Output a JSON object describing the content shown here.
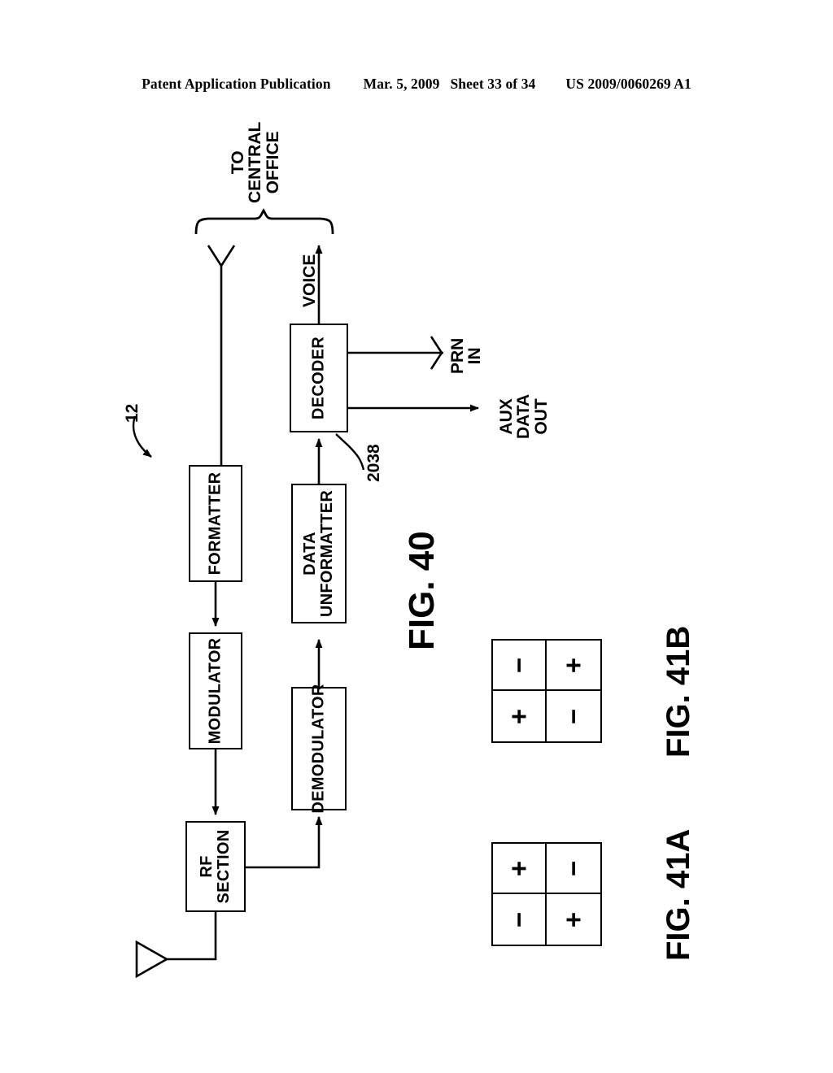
{
  "header": {
    "publication": "Patent Application Publication",
    "date": "Mar. 5, 2009",
    "sheet": "Sheet 33 of 34",
    "docnumber": "US 2009/0060269 A1"
  },
  "figure40": {
    "caption": "FIG. 40",
    "system_ref": "12",
    "decoder_ref": "2038",
    "brace_label": "TO\nCENTRAL\nOFFICE",
    "blocks": [
      {
        "id": "formatter",
        "label": "FORMATTER"
      },
      {
        "id": "modulator",
        "label": "MODULATOR"
      },
      {
        "id": "rf-section",
        "label": "RF\nSECTION"
      },
      {
        "id": "demodulator",
        "label": "DEMODULATOR"
      },
      {
        "id": "data-unformatter",
        "label": "DATA\nUNFORMATTER"
      },
      {
        "id": "decoder",
        "label": "DECODER"
      }
    ],
    "signals": [
      {
        "id": "voice",
        "label": "VOICE"
      },
      {
        "id": "prn-in",
        "label": "PRN\nIN"
      },
      {
        "id": "aux-data-out",
        "label": "AUX\nDATA\nOUT"
      }
    ]
  },
  "figure41b": {
    "caption": "FIG. 41B",
    "cells": [
      "−",
      "+",
      "+",
      "−"
    ]
  },
  "figure41a": {
    "caption": "FIG. 41A",
    "cells": [
      "+",
      "−",
      "−",
      "+"
    ]
  },
  "colors": {
    "ink": "#000000",
    "paper": "#ffffff"
  }
}
